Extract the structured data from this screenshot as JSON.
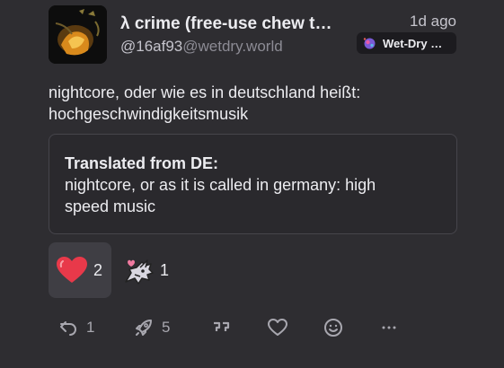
{
  "author": {
    "display_name": "λ crime (free-use chew t…",
    "handle_user": "@16af93",
    "handle_domain": "@wetdry.world",
    "avatar": "avatar-image"
  },
  "timestamp": "1d ago",
  "instance": {
    "name": "Wet-Dry …",
    "icon": "instance-icon"
  },
  "content": {
    "line1": "nightcore, oder wie es in deutschland heißt:",
    "line2": "hochgeschwindigkeitsmusik"
  },
  "translation": {
    "heading": "Translated from DE:",
    "line1": "nightcore, or as it is called in germany: high",
    "line2": "speed music"
  },
  "reactions": [
    {
      "icon": "heart-emoji",
      "count": "2",
      "active": true
    },
    {
      "icon": "dragon-heart-emoji",
      "count": "1",
      "active": false
    }
  ],
  "actions": {
    "reply": {
      "icon": "reply-icon",
      "count": "1"
    },
    "boost": {
      "icon": "rocket-icon",
      "count": "5"
    },
    "quote": {
      "icon": "quote-icon"
    },
    "react": {
      "icon": "heart-outline-icon"
    },
    "emoji": {
      "icon": "smiley-icon"
    },
    "more": {
      "icon": "ellipsis-icon"
    }
  },
  "colors": {
    "background": "#2e2d31",
    "text": "#ececf0",
    "muted": "#8c8b94",
    "heart": "#e8394a",
    "reaction_active_bg": "#3f3e44"
  }
}
